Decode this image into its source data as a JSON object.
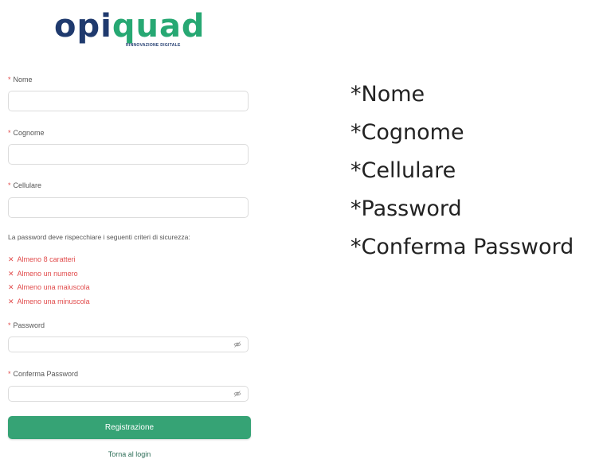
{
  "logo": {
    "brand_left": "opi",
    "brand_right": "quad",
    "tagline": "RINNOVAZIONE DIGITALE",
    "colors": {
      "primary": "#1f3a6e",
      "accent": "#27a873"
    }
  },
  "form": {
    "fields": [
      {
        "required_mark": "*",
        "label": "Nome"
      },
      {
        "required_mark": "*",
        "label": "Cognome"
      },
      {
        "required_mark": "*",
        "label": "Cellulare"
      }
    ],
    "password_info": "La password deve rispecchiare i seguenti criteri di sicurezza:",
    "criteria": [
      {
        "icon": "✕",
        "text": "Almeno 8 caratteri"
      },
      {
        "icon": "✕",
        "text": "Almeno un numero"
      },
      {
        "icon": "✕",
        "text": "Almeno una maiuscola"
      },
      {
        "icon": "✕",
        "text": "Almeno una minuscola"
      }
    ],
    "password": {
      "required_mark": "*",
      "label": "Password",
      "toggle_icon": "eye-off-icon"
    },
    "confirm_password": {
      "required_mark": "*",
      "label": "Conferma Password",
      "toggle_icon": "eye-off-icon"
    },
    "submit_label": "Registrazione",
    "login_link": "Torna al login",
    "colors": {
      "button": "#36a375",
      "error": "#e14b4b"
    }
  },
  "right_list": [
    "*Nome",
    "*Cognome",
    "*Cellulare",
    "*Password",
    "*Conferma Password"
  ]
}
